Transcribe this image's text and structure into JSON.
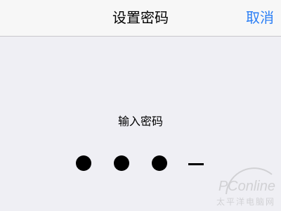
{
  "nav": {
    "title": "设置密码",
    "cancel_label": "取消"
  },
  "prompt": {
    "label": "输入密码"
  },
  "passcode": {
    "length": 4,
    "filled": 3
  },
  "watermark": {
    "brand": "PConline",
    "subtitle": "太平洋电脑网"
  },
  "colors": {
    "accent": "#2a7ef5",
    "background": "#efeff4",
    "navbar": "#f7f7f7"
  }
}
